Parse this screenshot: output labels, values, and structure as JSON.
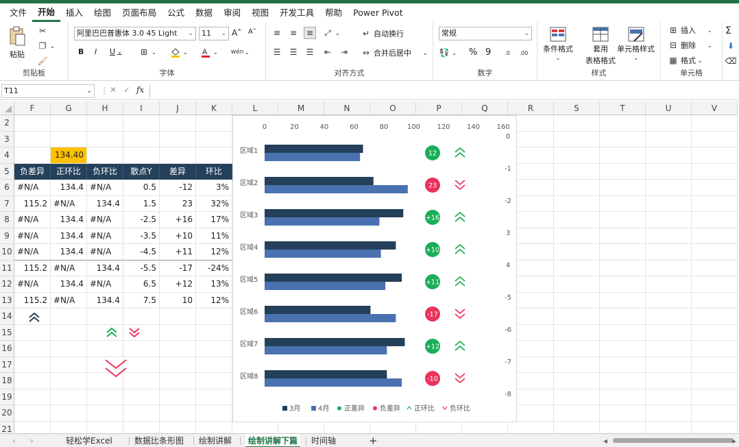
{
  "menu": [
    "文件",
    "开始",
    "插入",
    "绘图",
    "页面布局",
    "公式",
    "数据",
    "审阅",
    "视图",
    "开发工具",
    "帮助",
    "Power Pivot"
  ],
  "menu_active_index": 1,
  "ribbon": {
    "clipboard": {
      "paste": "粘贴",
      "label": "剪贴板"
    },
    "font": {
      "name": "阿里巴巴普惠体 3.0 45 Light",
      "size": "11",
      "bold": "B",
      "italic": "I",
      "underline": "U",
      "grow": "A˄",
      "shrink": "A˅",
      "label": "字体"
    },
    "alignment": {
      "wrap": "自动换行",
      "merge": "合并后居中",
      "label": "对齐方式"
    },
    "number": {
      "format": "常规",
      "percent": "%",
      "comma": "9",
      "label": "数字"
    },
    "styles": {
      "conditional": "条件格式",
      "table_line1": "套用",
      "table_line2": "表格格式",
      "cell_styles": "单元格样式",
      "label": "样式"
    },
    "cells": {
      "insert": "插入",
      "delete": "删除",
      "format": "格式",
      "label": "单元格"
    }
  },
  "formula_bar": {
    "name_box": "T11",
    "fx": "fx",
    "content": ""
  },
  "columns": [
    "F",
    "G",
    "H",
    "I",
    "J",
    "K",
    "L",
    "M",
    "N",
    "O",
    "P",
    "Q",
    "R",
    "S",
    "T",
    "U",
    "V"
  ],
  "rows": [
    "2",
    "3",
    "4",
    "5",
    "6",
    "7",
    "8",
    "9",
    "10",
    "11",
    "12",
    "13",
    "14",
    "15",
    "16",
    "17",
    "18",
    "19",
    "20",
    "21"
  ],
  "g4_value": "134.40",
  "table": {
    "headers": [
      "负差异",
      "正环比",
      "负环比",
      "散点Y",
      "差异",
      "环比"
    ],
    "rows": [
      [
        "#N/A",
        "134.4",
        "#N/A",
        "0.5",
        "-12",
        "3%"
      ],
      [
        "115.2",
        "#N/A",
        "134.4",
        "1.5",
        "23",
        "32%"
      ],
      [
        "#N/A",
        "134.4",
        "#N/A",
        "-2.5",
        "+16",
        "17%"
      ],
      [
        "#N/A",
        "134.4",
        "#N/A",
        "-3.5",
        "+10",
        "11%"
      ],
      [
        "#N/A",
        "134.4",
        "#N/A",
        "-4.5",
        "+11",
        "12%"
      ],
      [
        "115.2",
        "#N/A",
        "134.4",
        "-5.5",
        "-17",
        "-24%"
      ],
      [
        "#N/A",
        "134.4",
        "#N/A",
        "6.5",
        "+12",
        "13%"
      ],
      [
        "115.2",
        "#N/A",
        "134.4",
        "7.5",
        "10",
        "12%"
      ]
    ]
  },
  "chart_data": {
    "type": "bar",
    "categories": [
      "区域1",
      "区域2",
      "区域3",
      "区域4",
      "区域5",
      "区域6",
      "区域7",
      "区域8"
    ],
    "series": [
      {
        "name": "3月",
        "values": [
          66,
          73,
          93,
          88,
          92,
          71,
          94,
          82
        ]
      },
      {
        "name": "4月",
        "values": [
          64,
          96,
          77,
          78,
          81,
          88,
          82,
          92
        ]
      }
    ],
    "badges": [
      "12",
      "23",
      "+16",
      "+10",
      "+11",
      "-17",
      "+12",
      "-10"
    ],
    "badge_colors": [
      "#1aae58",
      "#e8335c",
      "#1aae58",
      "#1aae58",
      "#1aae58",
      "#e8335c",
      "#1aae58",
      "#e8335c"
    ],
    "trend": [
      "up",
      "down",
      "up",
      "up",
      "up",
      "down",
      "up",
      "down"
    ],
    "x_ticks": [
      "0",
      "20",
      "40",
      "60",
      "80",
      "100",
      "120",
      "140",
      "160"
    ],
    "xlim": [
      0,
      160
    ],
    "y2_ticks": [
      "0",
      "-1",
      "-2",
      "3",
      "4",
      "-5",
      "-6",
      "-7",
      "-8"
    ],
    "legend": [
      "3月",
      "4月",
      "正差异",
      "负差异",
      "正环比",
      "负环比"
    ],
    "colors": {
      "series1": "#24405a",
      "series2": "#4a72b0",
      "positive": "#1aae58",
      "negative": "#e8335c"
    }
  },
  "sheet_tabs": [
    "轻松学Excel",
    "数据比条形图",
    "绘制讲解",
    "绘制讲解下篇",
    "时间轴"
  ],
  "sheet_active_index": 3,
  "add_sheet": "+"
}
